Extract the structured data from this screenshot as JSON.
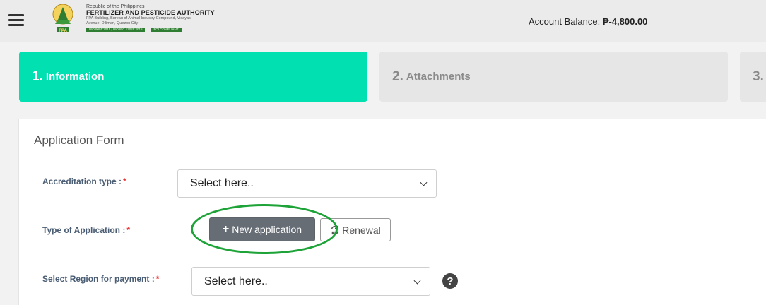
{
  "header": {
    "org_line1": "Republic of the Philippines",
    "org_line2": "FERTILIZER AND PESTICIDE AUTHORITY",
    "org_line3": "FPA Building, Bureau of Animal Industry Compound, Visayas",
    "org_line4": "Avenue, Diliman, Quezon City",
    "badge_iso": "ISO 9001:2015 | ISO/IEC 17025:2015",
    "badge_foi": "FOI COMPLIANT",
    "balance_label": "Account Balance:",
    "balance_value": "₱-4,800.00"
  },
  "steps": [
    {
      "num": "1.",
      "label": "Information",
      "active": true
    },
    {
      "num": "2.",
      "label": "Attachments",
      "active": false
    },
    {
      "num": "3.",
      "label": "",
      "active": false
    }
  ],
  "form": {
    "title": "Application Form",
    "accreditation_label": "Accreditation type :",
    "accreditation_value": "Select here..",
    "app_type_label": "Type of Application :",
    "new_application_label": "New application",
    "renewal_label": "Renewal",
    "region_label": "Select Region for payment :",
    "region_value": "Select here..",
    "required_mark": "*",
    "help_symbol": "?"
  },
  "colors": {
    "active_step": "#00e0b0",
    "inactive_step": "#e6e6e6",
    "required": "#ee3333",
    "highlight": "#1ea338"
  },
  "icons": [
    "menu-icon",
    "fpa-logo",
    "plus-icon",
    "renew-icon",
    "help-icon",
    "chevron-down-icon"
  ]
}
